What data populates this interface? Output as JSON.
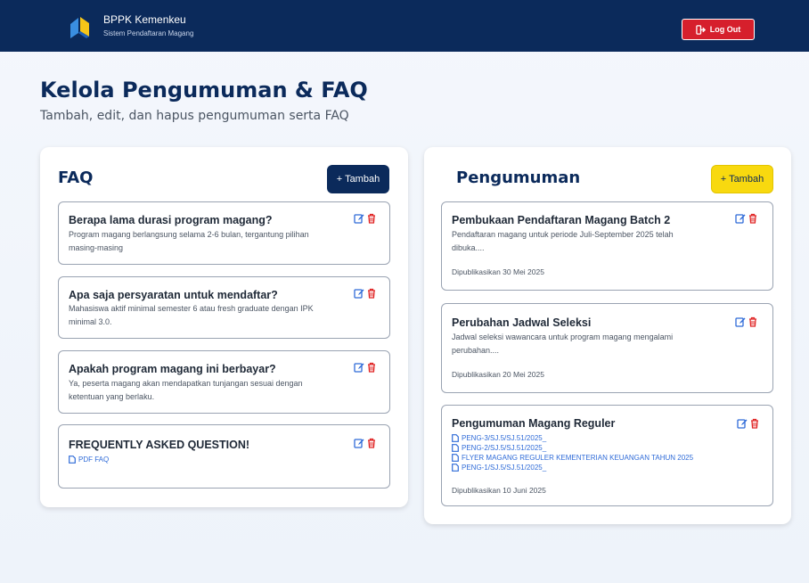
{
  "header": {
    "brand_title": "BPPK Kemenkeu",
    "brand_subtitle": "Sistem Pendaftaran Magang",
    "logout_label": "Log Out"
  },
  "page": {
    "title": "Kelola Pengumuman & FAQ",
    "subtitle": "Tambah, edit, dan hapus pengumuman serta FAQ"
  },
  "faq": {
    "heading": "FAQ",
    "add_label": "+ Tambah",
    "items": [
      {
        "question": "Berapa lama durasi program magang?",
        "answer": "Program magang berlangsung selama 2-6 bulan, tergantung pilihan masing-masing"
      },
      {
        "question": "Apa saja persyaratan untuk mendaftar?",
        "answer": "Mahasiswa aktif minimal semester 6 atau fresh graduate dengan IPK minimal 3.0."
      },
      {
        "question": "Apakah program magang ini berbayar?",
        "answer": "Ya, peserta magang akan mendapatkan tunjangan sesuai dengan ketentuan yang berlaku."
      },
      {
        "question": "FREQUENTLY ASKED QUESTION!",
        "link": "PDF FAQ"
      }
    ]
  },
  "announcements": {
    "heading": "Pengumuman",
    "add_label": "+ Tambah",
    "items": [
      {
        "title": "Pembukaan Pendaftaran Magang Batch 2",
        "body": "Pendaftaran magang untuk periode Juli-September 2025 telah dibuka....",
        "date": "Dipublikasikan 30 Mei 2025"
      },
      {
        "title": "Perubahan Jadwal Seleksi",
        "body": "Jadwal seleksi wawancara untuk program magang mengalami perubahan....",
        "date": "Dipublikasikan 20 Mei 2025"
      },
      {
        "title": "Pengumuman Magang Reguler",
        "links": [
          "PENG-3/SJ.5/SJ.51/2025_",
          "PENG-2/SJ.5/SJ.51/2025_",
          "FLYER MAGANG REGULER KEMENTERIAN KEUANGAN TAHUN 2025",
          "PENG-1/SJ.5/SJ.51/2025_"
        ],
        "date": "Dipublikasikan 10 Juni 2025"
      }
    ]
  },
  "colors": {
    "navy": "#0b2a5b",
    "logout_red": "#d61f2c",
    "add_yellow": "#f8d90f",
    "edit_blue": "#2f6bd8",
    "delete_red": "#e02424",
    "link_blue": "#2f6bd8"
  },
  "icons": {
    "logout": "logout-icon",
    "edit": "edit-icon",
    "delete": "trash-icon",
    "file": "file-icon",
    "logo": "kemenkeu-logo-icon"
  }
}
